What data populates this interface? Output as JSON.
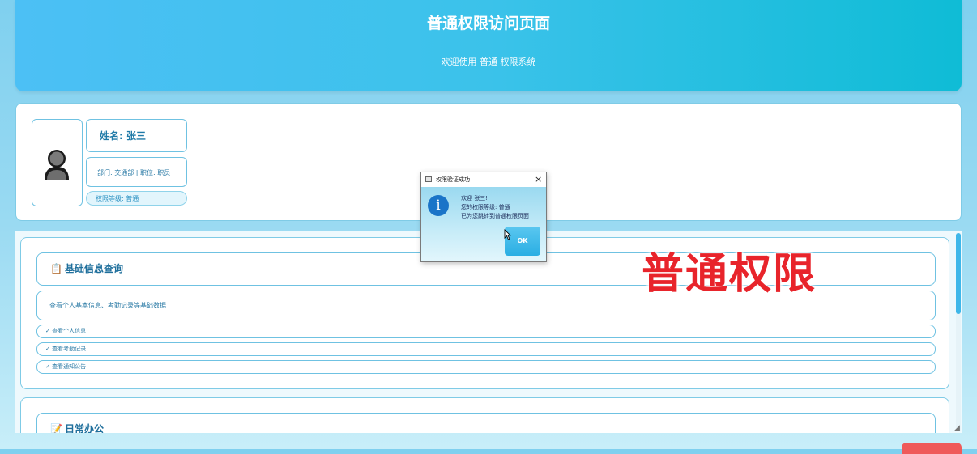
{
  "header": {
    "title": "普通权限访问页面",
    "subtitle": "欢迎使用 普通 权限系统"
  },
  "profile": {
    "avatar_icon": "person-icon",
    "name": "姓名: 张三",
    "dept_position": "部门: 交通部 | 职位: 职员",
    "level": "权限等级: 普通"
  },
  "modules": [
    {
      "icon": "clipboard-icon",
      "title": "基础信息查询",
      "description": "查看个人基本信息、考勤记录等基础数据",
      "features": [
        "✓ 查看个人信息",
        "✓ 查看考勤记录",
        "✓ 查看通知公告"
      ]
    },
    {
      "icon": "memo-icon",
      "title": "日常办公"
    }
  ],
  "watermark": "普通权限",
  "dialog": {
    "title": "权限验证成功",
    "close_label": "×",
    "lines": [
      "欢迎 张三!",
      "您的权限等级: 普通",
      "已为您跳转到普通权限页面"
    ],
    "ok_label": "OK"
  },
  "colors": {
    "header_start": "#4cc0f5",
    "header_end": "#0fbcd6",
    "accent": "#1f7aa8",
    "watermark": "#e8242b"
  }
}
